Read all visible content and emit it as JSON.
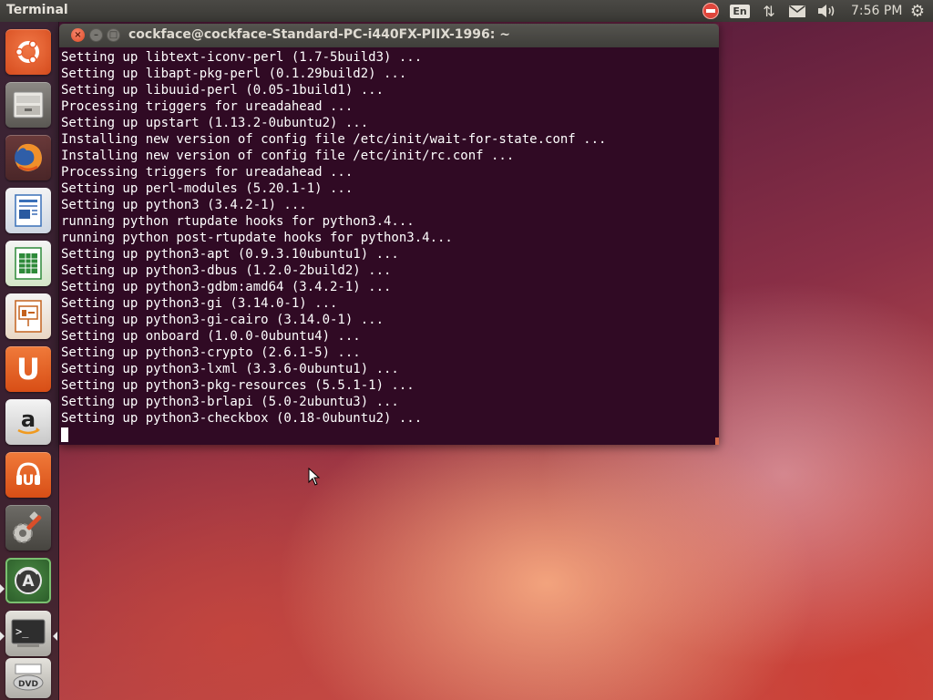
{
  "panel": {
    "app_title": "Terminal",
    "language": "En",
    "clock": "7:56 PM",
    "icons": [
      "stop-icon",
      "network-icon",
      "mail-icon",
      "sound-icon",
      "gear-icon"
    ]
  },
  "launcher": {
    "items": [
      {
        "name": "ubuntu-dash-icon",
        "label": "Dash"
      },
      {
        "name": "files-icon",
        "label": "Files"
      },
      {
        "name": "firefox-icon",
        "label": "Firefox"
      },
      {
        "name": "libreoffice-writer-icon",
        "label": "Writer"
      },
      {
        "name": "libreoffice-calc-icon",
        "label": "Calc"
      },
      {
        "name": "libreoffice-impress-icon",
        "label": "Impress"
      },
      {
        "name": "ubuntu-software-center-icon",
        "label": "U"
      },
      {
        "name": "amazon-icon",
        "label": "a"
      },
      {
        "name": "ubuntu-one-music-icon",
        "label": "U"
      },
      {
        "name": "system-settings-icon",
        "label": "Settings"
      },
      {
        "name": "software-updater-icon",
        "label": "A"
      },
      {
        "name": "terminal-icon",
        "label": ">_"
      },
      {
        "name": "dvd-icon",
        "label": "DVD"
      }
    ]
  },
  "terminal": {
    "window_title": "cockface@cockface-Standard-PC-i440FX-PIIX-1996: ~",
    "lines": [
      "Setting up libtext-iconv-perl (1.7-5build3) ...",
      "Setting up libapt-pkg-perl (0.1.29build2) ...",
      "Setting up libuuid-perl (0.05-1build1) ...",
      "Processing triggers for ureadahead ...",
      "Setting up upstart (1.13.2-0ubuntu2) ...",
      "Installing new version of config file /etc/init/wait-for-state.conf ...",
      "Installing new version of config file /etc/init/rc.conf ...",
      "Processing triggers for ureadahead ...",
      "Setting up perl-modules (5.20.1-1) ...",
      "Setting up python3 (3.4.2-1) ...",
      "running python rtupdate hooks for python3.4...",
      "running python post-rtupdate hooks for python3.4...",
      "Setting up python3-apt (0.9.3.10ubuntu1) ...",
      "Setting up python3-dbus (1.2.0-2build2) ...",
      "Setting up python3-gdbm:amd64 (3.4.2-1) ...",
      "Setting up python3-gi (3.14.0-1) ...",
      "Setting up python3-gi-cairo (3.14.0-1) ...",
      "Setting up onboard (1.0.0-0ubuntu4) ...",
      "Setting up python3-crypto (2.6.1-5) ...",
      "Setting up python3-lxml (3.3.6-0ubuntu1) ...",
      "Setting up python3-pkg-resources (5.5.1-1) ...",
      "Setting up python3-brlapi (5.0-2ubuntu3) ...",
      "Setting up python3-checkbox (0.18-0ubuntu2) ..."
    ]
  }
}
